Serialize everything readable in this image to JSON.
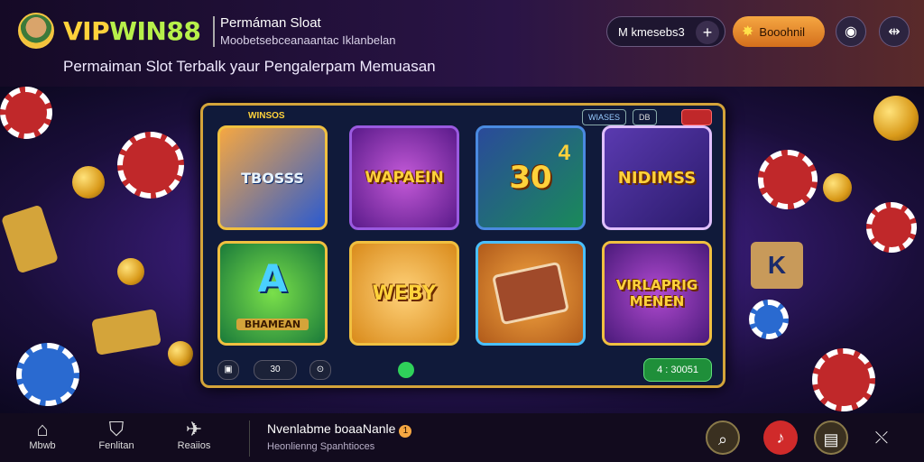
{
  "header": {
    "brand_part1": "VIP",
    "brand_part2": "WIN88",
    "title": "Permáman Sloat",
    "subtitle": "Moobetsebceanaantac Iklanbelan",
    "tagline": "Permaiman Slot Terbalk yaur Pengalerpam Memuasan",
    "wallet_label": "M kmesebs3",
    "bonus_label": "Booohnil",
    "icons": [
      "plus-icon",
      "star-icon",
      "user-icon",
      "menu-icon"
    ]
  },
  "slot_frame": {
    "brand": "WINSOS",
    "tabs": [
      "WIASES",
      "DB",
      ""
    ],
    "tiles": [
      {
        "label": "TBOSSS"
      },
      {
        "label": "WAPAEIN"
      },
      {
        "label": "30"
      },
      {
        "label": "NIDIMSS"
      },
      {
        "label": "BHAMEAN"
      },
      {
        "label": "WEBY"
      },
      {
        "label": ""
      },
      {
        "label": "VIRLAPRIG MENEN"
      }
    ],
    "tile_badges": [
      "A",
      "4",
      "K"
    ],
    "ctrl_value": "30",
    "win_value": "4 : 30051"
  },
  "footer": {
    "nav": [
      {
        "label": "Mbwb",
        "icon": "home-icon"
      },
      {
        "label": "Fenlitan",
        "icon": "bag-icon"
      },
      {
        "label": "Reaiios",
        "icon": "send-icon"
      }
    ],
    "title": "Nvenlabme boaaNanle",
    "title_badge": "1",
    "subtitle": "Heonlienng Spanhtioces",
    "colors": {
      "accent": "#f5a742",
      "brand_yellow": "#ffd23b",
      "brand_green": "#b7f04a",
      "win_green": "#1f8f3a"
    }
  }
}
